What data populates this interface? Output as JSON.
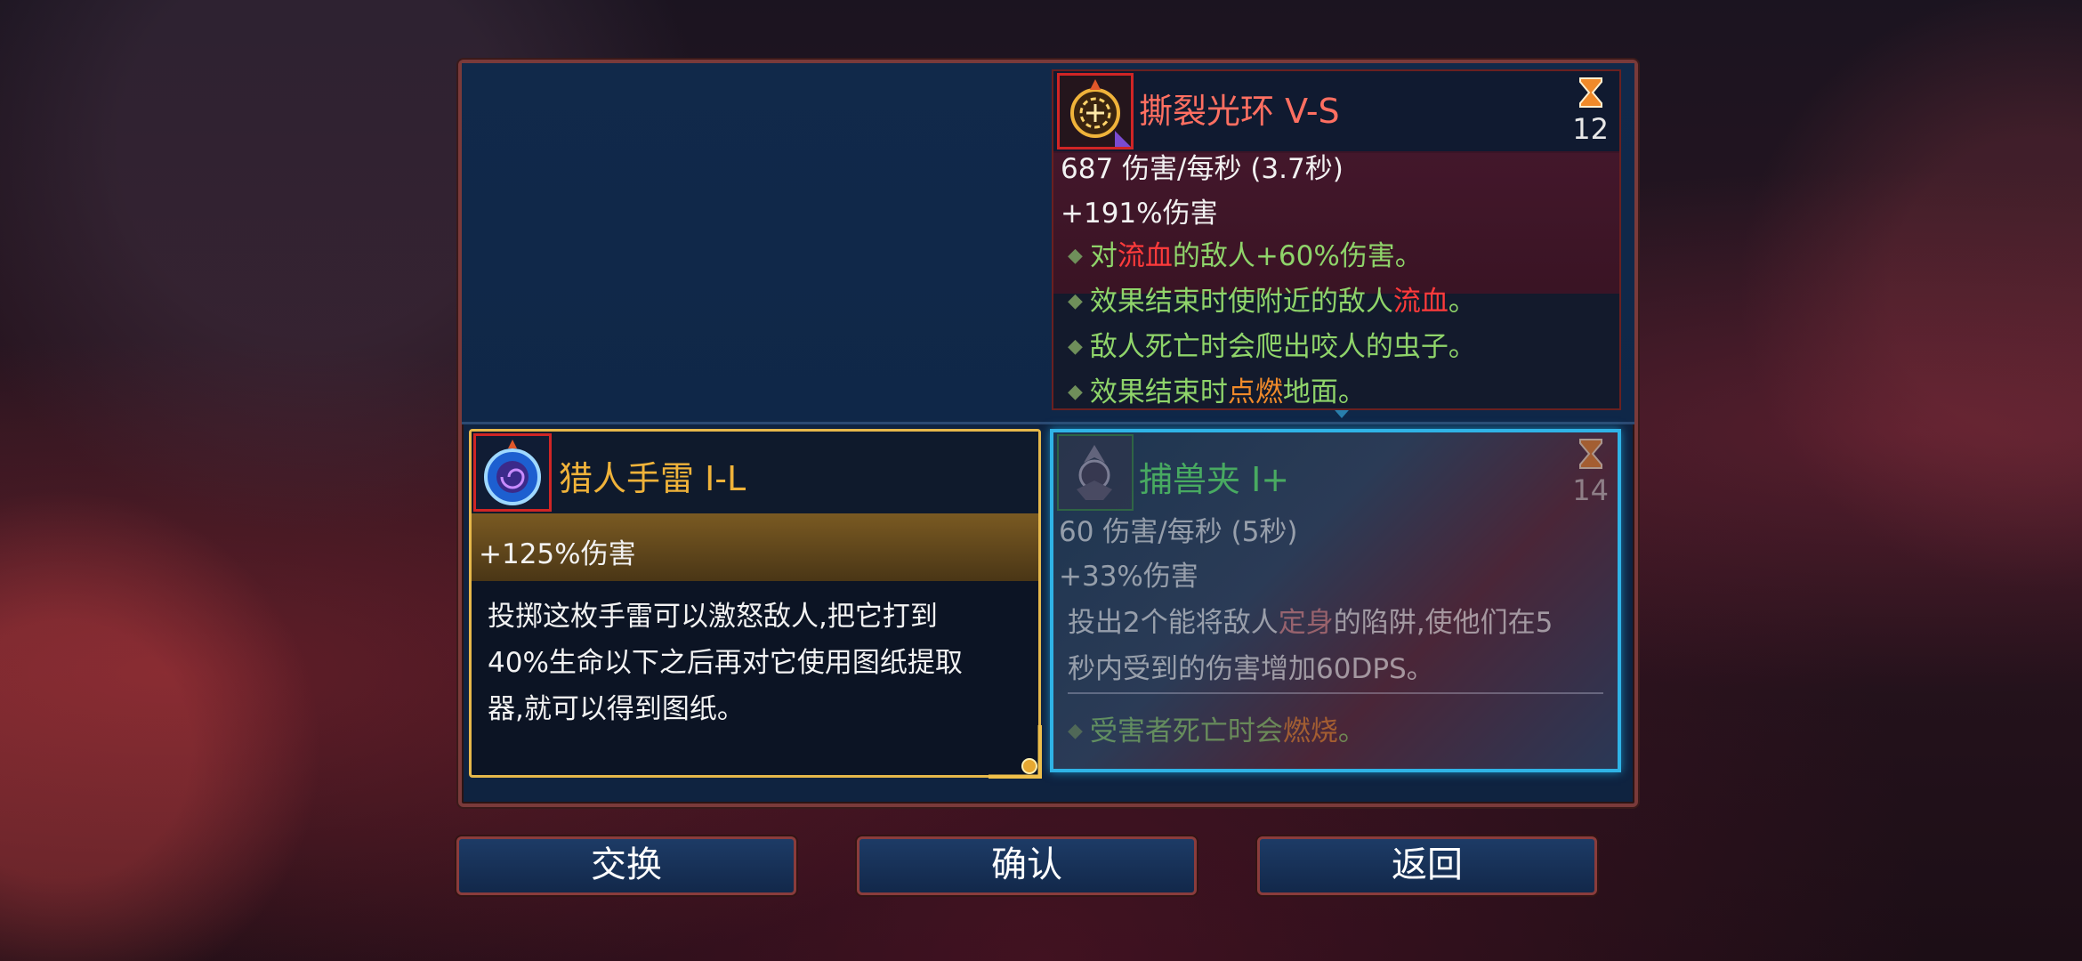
{
  "aura": {
    "title": "撕裂光环 V-S",
    "timer": "12",
    "dps": "687 伤害/每秒 (3.7秒)",
    "bonus": "+191%伤害",
    "effects": [
      {
        "a": "对",
        "b": "流血",
        "c": "的敌人+60%伤害。"
      },
      {
        "a": "效果结束时使附近的敌人",
        "b": "流血",
        "c": "。"
      },
      {
        "a": "敌人死亡时会爬出咬人的虫子。",
        "b": "",
        "c": ""
      },
      {
        "a": "效果结束时",
        "b": "点燃",
        "c": "地面。"
      }
    ]
  },
  "grenade": {
    "title": "猎人手雷 I-L",
    "bonus": "+125%伤害",
    "desc": [
      "投掷这枚手雷可以激怒敌人,把它打到",
      "40%生命以下之后再对它使用图纸提取",
      "器,就可以得到图纸。"
    ]
  },
  "trap": {
    "title": "捕兽夹 I+",
    "timer": "14",
    "dps": "60 伤害/每秒 (5秒)",
    "bonus": "+33%伤害",
    "desc_line1_a": "投出2个能将敌人",
    "desc_line1_b": "定身",
    "desc_line1_c": "的陷阱,使他们在5",
    "desc_line2": "秒内受到的伤害增加60DPS。",
    "effect_a": "受害者死亡时会",
    "effect_b": "燃烧",
    "effect_c": "。"
  },
  "buttons": {
    "swap": "交换",
    "confirm": "确认",
    "back": "返回"
  },
  "colors": {
    "bleed": "#ff3b3b",
    "burn": "#f08a2a",
    "effect_text": "#8fd46a",
    "gold": "#f0b33a",
    "trap_border": "#2fb3e6"
  },
  "icons": {
    "aura": "torn-aura-icon",
    "grenade": "hunter-grenade-icon",
    "trap": "bear-trap-icon",
    "timer": "hourglass-icon"
  }
}
